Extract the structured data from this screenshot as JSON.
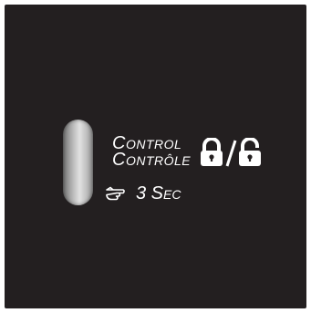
{
  "control": {
    "label_en": "Control",
    "label_fr": "Contrôle",
    "hold_time": "3 Sec",
    "icons": [
      "lock-icon",
      "unlock-icon",
      "pointing-hand-icon"
    ]
  }
}
